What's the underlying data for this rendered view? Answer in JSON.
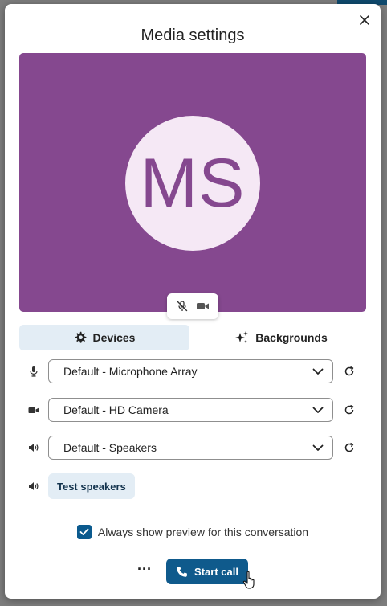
{
  "dialog": {
    "title": "Media settings",
    "avatar_initials": "MS",
    "preview_color": "#85488f"
  },
  "media_toggles": {
    "mic_icon": "mic-off-icon",
    "camera_icon": "video-camera-icon"
  },
  "tabs": [
    {
      "label": "Devices",
      "icon": "gear-icon",
      "active": true
    },
    {
      "label": "Backgrounds",
      "icon": "sparkles-icon",
      "active": false
    }
  ],
  "devices": {
    "microphone": {
      "icon": "microphone-icon",
      "value": "Default - Microphone Array"
    },
    "camera": {
      "icon": "camera-icon",
      "value": "Default - HD Camera"
    },
    "speakers": {
      "icon": "speaker-icon",
      "value": "Default - Speakers"
    }
  },
  "test_speakers_label": "Test speakers",
  "preview_option": {
    "label": "Always show preview for this conversation",
    "checked": true
  },
  "footer": {
    "more_label": "···",
    "start_call_label": "Start call"
  },
  "colors": {
    "accent": "#0f5a8c",
    "tab_active_bg": "#e3edf5"
  }
}
